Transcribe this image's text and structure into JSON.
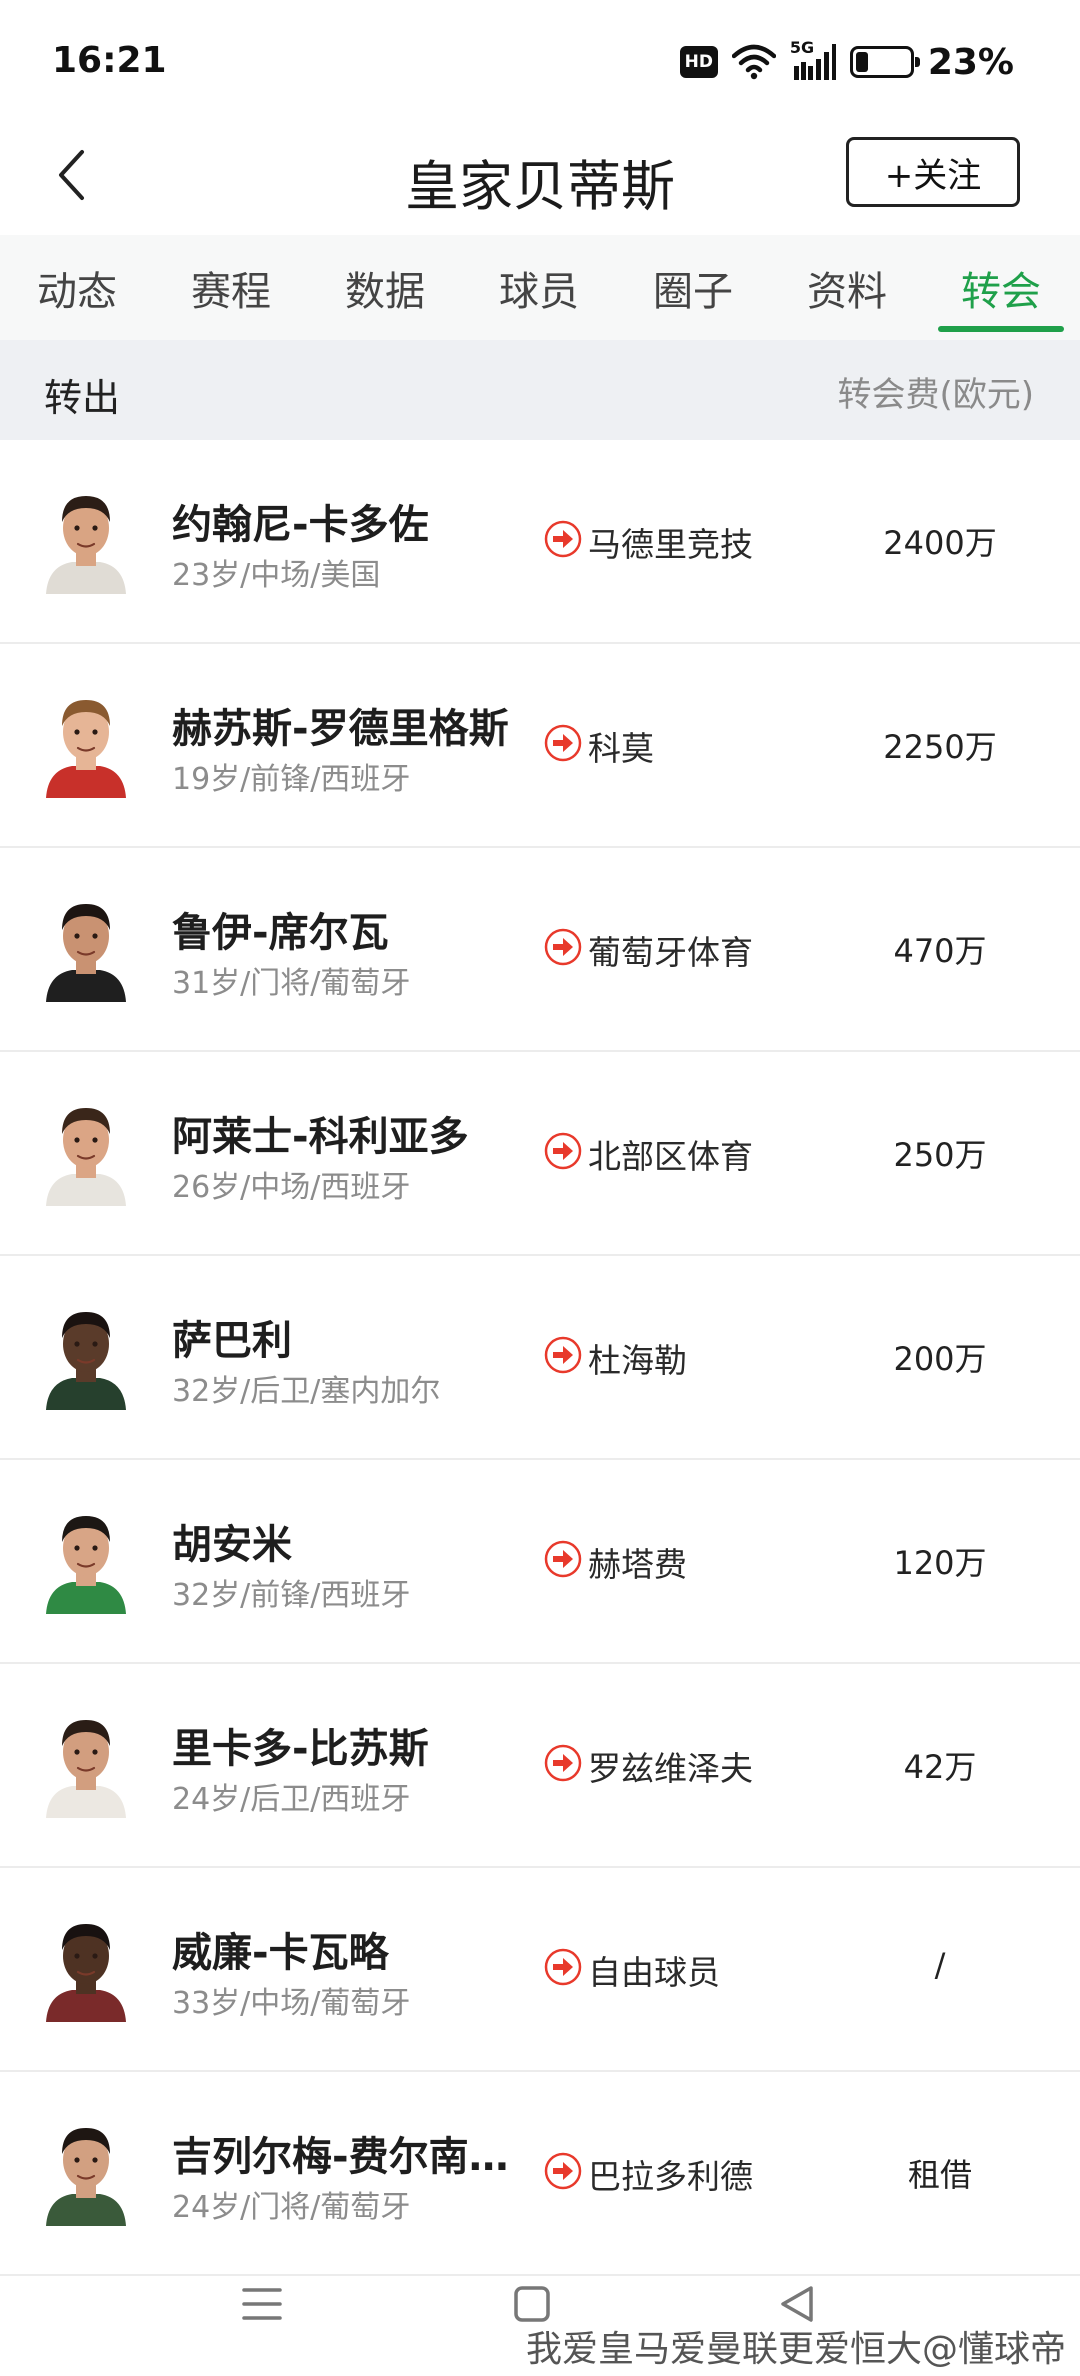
{
  "status_bar": {
    "time": "16:21",
    "hd_label": "HD",
    "network_label": "5G",
    "battery_text": "23%",
    "battery_level": 0.23,
    "icons": [
      "hd-icon",
      "wifi-icon",
      "signal-5g-icon",
      "battery-icon"
    ]
  },
  "header": {
    "back_icon": "chevron-left-icon",
    "title": "皇家贝蒂斯",
    "follow_label": "+关注"
  },
  "tabs": [
    {
      "label": "动态",
      "active": false
    },
    {
      "label": "赛程",
      "active": false
    },
    {
      "label": "数据",
      "active": false
    },
    {
      "label": "球员",
      "active": false
    },
    {
      "label": "圈子",
      "active": false
    },
    {
      "label": "资料",
      "active": false
    },
    {
      "label": "转会",
      "active": true
    }
  ],
  "section": {
    "title": "转出",
    "fee_label": "转会费(欧元)"
  },
  "colors": {
    "accent": "#1fa04a",
    "transfer_arrow": "#e8392b",
    "section_bg": "#eef0f3"
  },
  "transfers": [
    {
      "name": "约翰尼-卡多佐",
      "meta": "23岁/中场/美国",
      "club": "马德里竞技",
      "fee": "2400万",
      "skin": "#d9a483",
      "hair": "#2b1d16",
      "shirt": "#e0dcd5"
    },
    {
      "name": "赫苏斯-罗德里格斯",
      "meta": "19岁/前锋/西班牙",
      "club": "科莫",
      "fee": "2250万",
      "skin": "#e6b596",
      "hair": "#8a5a30",
      "shirt": "#c8302a"
    },
    {
      "name": "鲁伊-席尔瓦",
      "meta": "31岁/门将/葡萄牙",
      "club": "葡萄牙体育",
      "fee": "470万",
      "skin": "#c99272",
      "hair": "#1d1512",
      "shirt": "#1f1f1f"
    },
    {
      "name": "阿莱士-科利亚多",
      "meta": "26岁/中场/西班牙",
      "club": "北部区体育",
      "fee": "250万",
      "skin": "#dba585",
      "hair": "#3a261a",
      "shirt": "#e7e4de"
    },
    {
      "name": "萨巴利",
      "meta": "32岁/后卫/塞内加尔",
      "club": "杜海勒",
      "fee": "200万",
      "skin": "#5a3b2a",
      "hair": "#1a1210",
      "shirt": "#26402d"
    },
    {
      "name": "胡安米",
      "meta": "32岁/前锋/西班牙",
      "club": "赫塔费",
      "fee": "120万",
      "skin": "#d8a586",
      "hair": "#1c1714",
      "shirt": "#2f8a44"
    },
    {
      "name": "里卡多-比苏斯",
      "meta": "24岁/后卫/西班牙",
      "club": "罗兹维泽夫",
      "fee": "42万",
      "skin": "#d29e7f",
      "hair": "#2a1d16",
      "shirt": "#ece8e2"
    },
    {
      "name": "威廉-卡瓦略",
      "meta": "33岁/中场/葡萄牙",
      "club": "自由球员",
      "fee": "/",
      "skin": "#4e3223",
      "hair": "#181110",
      "shirt": "#7a2a2a"
    },
    {
      "name": "吉列尔梅-费尔南…",
      "meta": "24岁/门将/葡萄牙",
      "club": "巴拉多利德",
      "fee": "租借",
      "skin": "#d2a081",
      "hair": "#1e1612",
      "shirt": "#3a5a3a"
    }
  ],
  "bottom_nav": {
    "icons": [
      "menu-icon",
      "home-square-icon",
      "back-triangle-icon"
    ],
    "watermark": "我爱皇马爱曼联更爱恒大@懂球帝"
  }
}
